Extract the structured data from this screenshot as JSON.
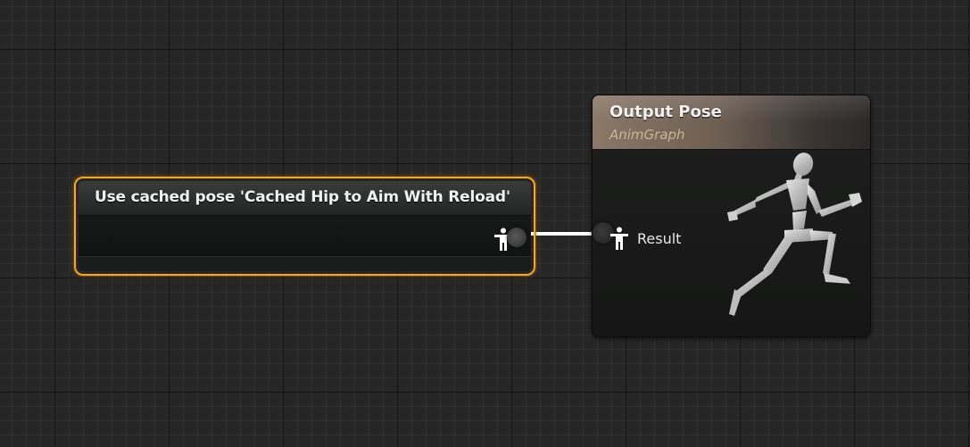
{
  "graph": {
    "background_color": "#262626",
    "wire_color": "#ffffff"
  },
  "cached_pose_node": {
    "title": "Use cached pose 'Cached Hip to Aim With Reload'",
    "border_color": "#f5a623",
    "output_pin_icon": "pose-person-icon"
  },
  "output_pose_node": {
    "title": "Output Pose",
    "subtitle": "AnimGraph",
    "header_color": "#8a7868",
    "subtitle_color": "#c9b690",
    "input_pin": {
      "label": "Result",
      "icon": "pose-person-icon"
    },
    "illustration": "running-mannequin-icon"
  }
}
